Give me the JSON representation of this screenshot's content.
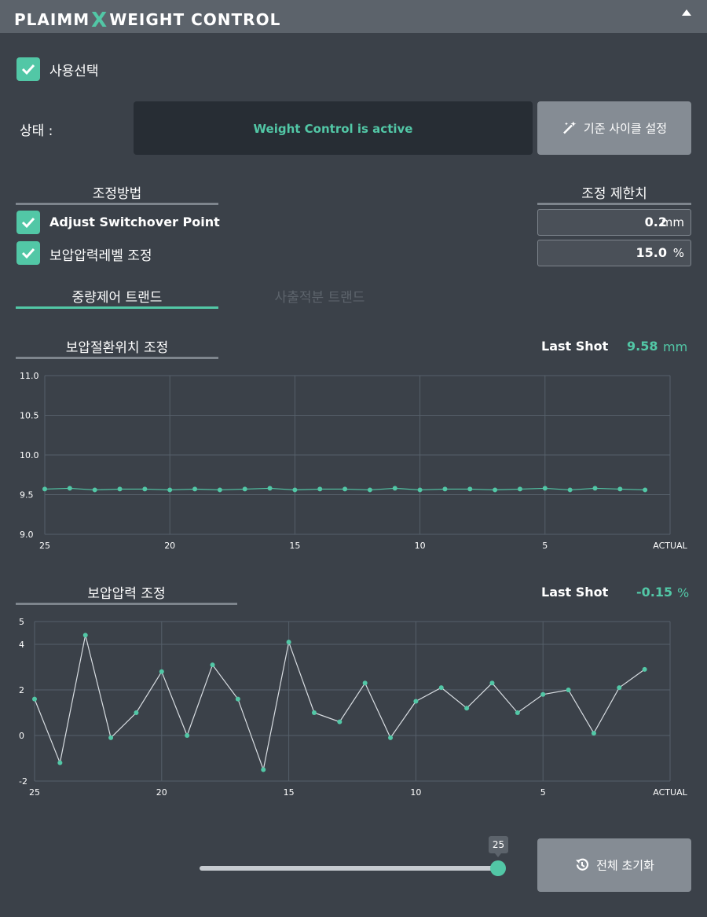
{
  "header": {
    "brand_left": "PLAIMM",
    "brand_x": "X",
    "brand_right": "WEIGHT CONTROL"
  },
  "enable": {
    "label": "사용선택",
    "checked": true
  },
  "status": {
    "label": "상태 :",
    "value": "Weight Control is active"
  },
  "ref_cycle_button": {
    "label": "기준 사이클 설정",
    "icon": "magic-wand-icon"
  },
  "method": {
    "title": "조정방법",
    "options": [
      {
        "label": "Adjust Switchover Point",
        "checked": true
      },
      {
        "label": "보압압력레벨 조정",
        "checked": true
      }
    ]
  },
  "limits": {
    "title": "조정 제한치",
    "fields": [
      {
        "value": "0.2",
        "unit": "mm"
      },
      {
        "value": "15.0",
        "unit": "%"
      }
    ]
  },
  "tabs": [
    {
      "label": "중량제어 트랜드",
      "active": true
    },
    {
      "label": "사출적분 트랜드",
      "active": false
    }
  ],
  "charts": {
    "switchover": {
      "title": "보압절환위치 조정",
      "last_shot_label": "Last Shot",
      "last_shot_value": "9.58",
      "last_shot_unit": "mm"
    },
    "pressure": {
      "title": "보압압력 조정",
      "last_shot_label": "Last Shot",
      "last_shot_value": "-0.15",
      "last_shot_unit": "%"
    }
  },
  "chart_data": [
    {
      "type": "line",
      "title": "보압절환위치 조정",
      "x_ticks": [
        "25",
        "20",
        "15",
        "10",
        "5",
        "ACTUAL"
      ],
      "y_ticks": [
        "11.0",
        "10.5",
        "10.0",
        "9.5",
        "9.0"
      ],
      "ylim": [
        9.0,
        11.0
      ],
      "x": [
        25,
        24,
        23,
        22,
        21,
        20,
        19,
        18,
        17,
        16,
        15,
        14,
        13,
        12,
        11,
        10,
        9,
        8,
        7,
        6,
        5,
        4,
        3,
        2,
        1,
        0
      ],
      "values": [
        9.57,
        9.58,
        9.56,
        9.57,
        9.57,
        9.56,
        9.57,
        9.56,
        9.57,
        9.58,
        9.56,
        9.57,
        9.57,
        9.56,
        9.58,
        9.56,
        9.57,
        9.57,
        9.56,
        9.57,
        9.58,
        9.56,
        9.58,
        9.57,
        9.56
      ],
      "color": "#52c7a6"
    },
    {
      "type": "line",
      "title": "보압압력 조정",
      "x_ticks": [
        "25",
        "20",
        "15",
        "10",
        "5",
        "ACTUAL"
      ],
      "y_ticks": [
        "5",
        "4",
        "2",
        "0",
        "-2"
      ],
      "ylim": [
        -2,
        5
      ],
      "x": [
        25,
        24,
        23,
        22,
        21,
        20,
        19,
        18,
        17,
        16,
        15,
        14,
        13,
        12,
        11,
        10,
        9,
        8,
        7,
        6,
        5,
        4,
        3,
        2,
        1,
        0
      ],
      "values": [
        1.6,
        -1.2,
        4.4,
        -0.1,
        1.0,
        2.8,
        0.0,
        3.1,
        1.6,
        -1.5,
        4.1,
        1.0,
        0.6,
        2.3,
        -0.1,
        1.5,
        2.1,
        1.2,
        2.3,
        1.0,
        1.8,
        2.0,
        0.1,
        2.1,
        2.9
      ],
      "color": "#52c7a6",
      "line_color": "#d8dde2"
    }
  ],
  "slider": {
    "value": "25",
    "min": 0,
    "max": 25
  },
  "reset_button": {
    "label": "전체 초기화",
    "icon": "history-icon"
  },
  "colors": {
    "accent": "#52c7a6",
    "panel": "#3b4149",
    "header": "#5c636b",
    "button": "#858c94"
  }
}
